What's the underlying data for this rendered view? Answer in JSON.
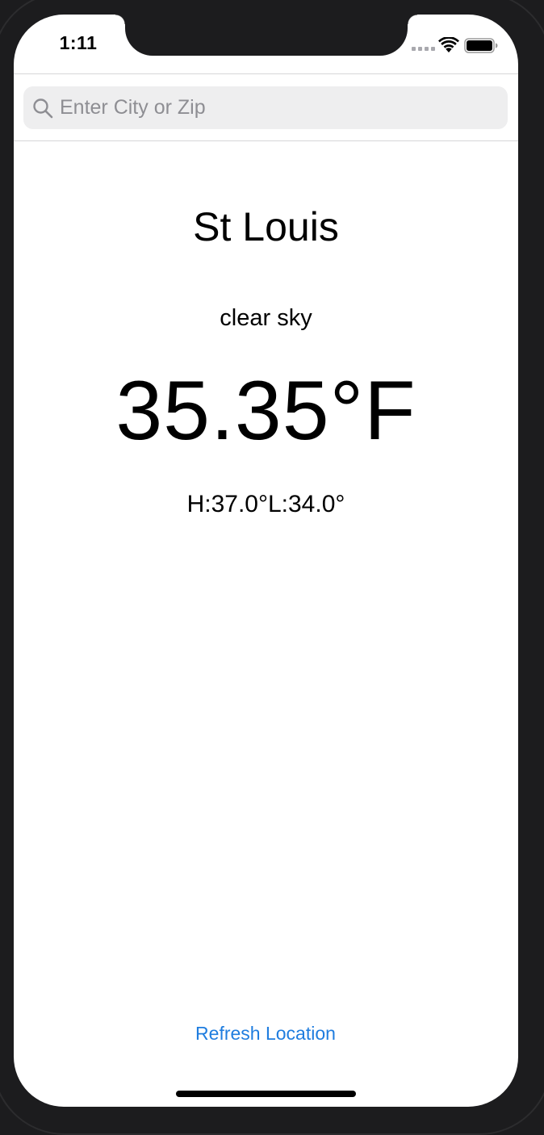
{
  "status_bar": {
    "time": "1:11"
  },
  "search": {
    "placeholder": "Enter City or Zip",
    "value": ""
  },
  "weather": {
    "city": "St Louis",
    "condition": "clear sky",
    "temperature": "35.35°F",
    "high_low": "H:37.0°L:34.0°"
  },
  "actions": {
    "refresh_label": "Refresh Location"
  },
  "colors": {
    "accent": "#1f7ddf",
    "background": "#ffffff",
    "bezel": "#1c1c1e",
    "search_field": "#eeeeef",
    "placeholder": "#8e8e93"
  }
}
